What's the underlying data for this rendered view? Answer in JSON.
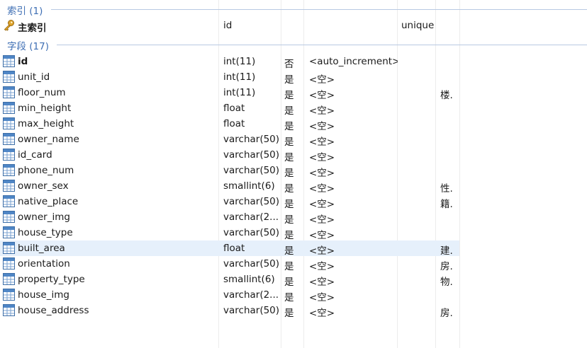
{
  "indexes": {
    "title": "索引 (1)",
    "rows": [
      {
        "name": "主索引",
        "field": "id",
        "kind": "unique"
      }
    ]
  },
  "fields": {
    "title": "字段 (17)",
    "rows": [
      {
        "name": "id",
        "type": "int(11)",
        "nullable": "否",
        "default": "<auto_increment>",
        "comment": ""
      },
      {
        "name": "unit_id",
        "type": "int(11)",
        "nullable": "是",
        "default": "<空>",
        "comment": ""
      },
      {
        "name": "floor_num",
        "type": "int(11)",
        "nullable": "是",
        "default": "<空>",
        "comment": "楼."
      },
      {
        "name": "min_height",
        "type": "float",
        "nullable": "是",
        "default": "<空>",
        "comment": ""
      },
      {
        "name": "max_height",
        "type": "float",
        "nullable": "是",
        "default": "<空>",
        "comment": ""
      },
      {
        "name": "owner_name",
        "type": "varchar(50)",
        "nullable": "是",
        "default": "<空>",
        "comment": ""
      },
      {
        "name": "id_card",
        "type": "varchar(50)",
        "nullable": "是",
        "default": "<空>",
        "comment": ""
      },
      {
        "name": "phone_num",
        "type": "varchar(50)",
        "nullable": "是",
        "default": "<空>",
        "comment": ""
      },
      {
        "name": "owner_sex",
        "type": "smallint(6)",
        "nullable": "是",
        "default": "<空>",
        "comment": "性."
      },
      {
        "name": "native_place",
        "type": "varchar(50)",
        "nullable": "是",
        "default": "<空>",
        "comment": "籍."
      },
      {
        "name": "owner_img",
        "type": "varchar(2...",
        "nullable": "是",
        "default": "<空>",
        "comment": ""
      },
      {
        "name": "house_type",
        "type": "varchar(50)",
        "nullable": "是",
        "default": "<空>",
        "comment": ""
      },
      {
        "name": "built_area",
        "type": "float",
        "nullable": "是",
        "default": "<空>",
        "comment": "建."
      },
      {
        "name": "orientation",
        "type": "varchar(50)",
        "nullable": "是",
        "default": "<空>",
        "comment": "房."
      },
      {
        "name": "property_type",
        "type": "smallint(6)",
        "nullable": "是",
        "default": "<空>",
        "comment": "物."
      },
      {
        "name": "house_img",
        "type": "varchar(2...",
        "nullable": "是",
        "default": "<空>",
        "comment": ""
      },
      {
        "name": "house_address",
        "type": "varchar(50)",
        "nullable": "是",
        "default": "<空>",
        "comment": "房."
      }
    ]
  },
  "selected_field": "built_area",
  "icons": {
    "index": "key-icon",
    "field": "table-icon"
  },
  "colors": {
    "section_title": "#3f6fb4",
    "selection": "#e6f0fb",
    "key": "#e0a52c"
  }
}
